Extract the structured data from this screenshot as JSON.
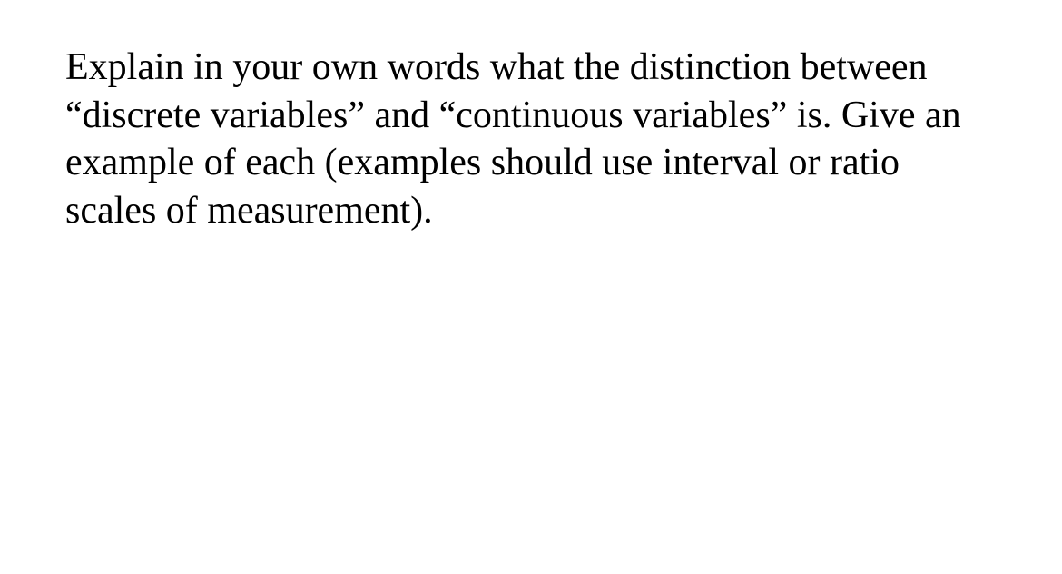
{
  "question": {
    "text": "Explain in your own words what the distinction between “discrete variables” and “continuous variables” is. Give an example of each (examples should use interval or ratio scales of measurement)."
  }
}
